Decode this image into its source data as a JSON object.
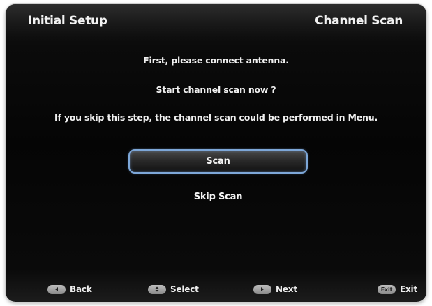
{
  "header": {
    "title": "Initial Setup",
    "section": "Channel Scan"
  },
  "messages": {
    "line1": "First, please connect antenna.",
    "line2": "Start channel scan now ?",
    "line3": "If you skip this step, the channel scan could be performed in Menu."
  },
  "options": {
    "scan_label": "Scan",
    "skip_label": "Skip Scan",
    "selected": "Scan"
  },
  "footer": {
    "back_label": "Back",
    "select_label": "Select",
    "next_label": "Next",
    "exit_label": "Exit",
    "exit_key_text": "Exit"
  },
  "colors": {
    "background": "#050505",
    "text": "#f0f0f0",
    "focus_border": "#7da7d8",
    "key_icon": "#a5a5a5"
  },
  "icons": {
    "back": "left-arrow-key-icon",
    "select": "ok-key-icon",
    "next": "right-arrow-key-icon",
    "exit": "exit-key-icon"
  }
}
